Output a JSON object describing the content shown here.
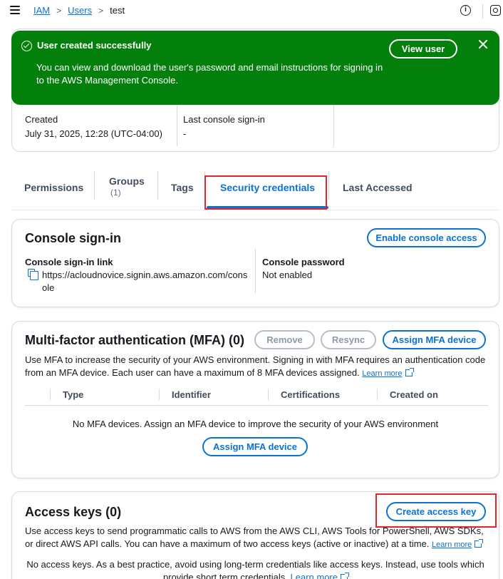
{
  "breadcrumb": {
    "iam": "IAM",
    "users": "Users",
    "current": "test",
    "sep": ">"
  },
  "icons": {
    "menu": "menu-icon",
    "info": "info-icon",
    "settings": "gear-icon",
    "success": "check-circle-icon",
    "close": "close-icon",
    "copy": "copy-icon",
    "external": "external-link-icon"
  },
  "flash": {
    "title": "User created successfully",
    "body": "You can view and download the user's password and email instructions for signing in to the AWS Management Console.",
    "button": "View user",
    "color": "#037f0c"
  },
  "details": {
    "created_label": "Created",
    "created_value": "July 31, 2025, 12:28 (UTC-04:00)",
    "signin_label": "Last console sign-in",
    "signin_value": "-"
  },
  "tabs": [
    {
      "label": "Permissions"
    },
    {
      "label": "Groups",
      "count": "(1)"
    },
    {
      "label": "Tags"
    },
    {
      "label": "Security credentials",
      "active": true
    },
    {
      "label": "Last Accessed"
    }
  ],
  "console_signin": {
    "title": "Console sign-in",
    "button": "Enable console access",
    "link_label": "Console sign-in link",
    "link_value_1": "https://acloudnovice.signin.aws.amazon.com/cons",
    "link_value_2": "ole",
    "password_label": "Console password",
    "password_value": "Not enabled"
  },
  "mfa": {
    "title": "Multi-factor authentication (MFA) (0)",
    "remove": "Remove",
    "resync": "Resync",
    "assign": "Assign MFA device",
    "description": "Use MFA to increase the security of your AWS environment. Signing in with MFA requires an authentication code from an MFA device. Each user can have a maximum of 8 MFA devices assigned.",
    "learn_more": "Learn more",
    "columns": [
      "Type",
      "Identifier",
      "Certifications",
      "Created on"
    ],
    "empty": "No MFA devices. Assign an MFA device to improve the security of your AWS environment",
    "empty_button": "Assign MFA device"
  },
  "access_keys": {
    "title": "Access keys (0)",
    "button": "Create access key",
    "description": "Use access keys to send programmatic calls to AWS from the AWS CLI, AWS Tools for PowerShell, AWS SDKs, or direct AWS API calls. You can have a maximum of two access keys (active or inactive) at a time.",
    "learn_more": "Learn more",
    "empty_1": "No access keys. As a best practice, avoid using long-term credentials like access keys. Instead, use tools which",
    "empty_2": "provide short term credentials.",
    "empty_learn_more": "Learn more"
  },
  "colors": {
    "accent": "#0972d3",
    "highlight": "#e0262b",
    "success": "#037f0c"
  }
}
